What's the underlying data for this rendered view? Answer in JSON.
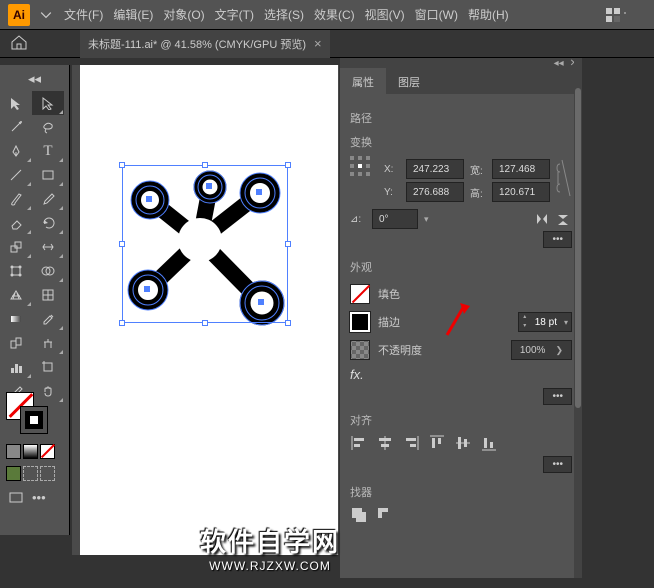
{
  "app": {
    "logo": "Ai"
  },
  "menubar": {
    "items": [
      "文件(F)",
      "编辑(E)",
      "对象(O)",
      "文字(T)",
      "选择(S)",
      "效果(C)",
      "视图(V)",
      "窗口(W)",
      "帮助(H)"
    ]
  },
  "tab": {
    "title": "未标题-111.ai* @ 41.58% (CMYK/GPU 预览)",
    "close": "×"
  },
  "panel": {
    "tabs": [
      "属性",
      "图层"
    ],
    "path_label": "路径",
    "transform": {
      "label": "变换",
      "x_label": "X:",
      "x": "247.223",
      "y_label": "Y:",
      "y": "276.688",
      "w_label": "宽:",
      "w": "127.468",
      "h_label": "高:",
      "h": "120.671",
      "angle_label": "⊿:",
      "angle": "0°"
    },
    "appearance": {
      "label": "外观",
      "fill_label": "填色",
      "stroke_label": "描边",
      "stroke_value": "18 pt",
      "opacity_label": "不透明度",
      "opacity_value": "100%",
      "fx_label": "fx.",
      "more": "•••"
    },
    "align": {
      "label": "对齐",
      "more": "•••"
    },
    "finder_label": "找器"
  },
  "watermark": {
    "cn": "软件自学网",
    "url": "WWW.RJZXW.COM"
  }
}
